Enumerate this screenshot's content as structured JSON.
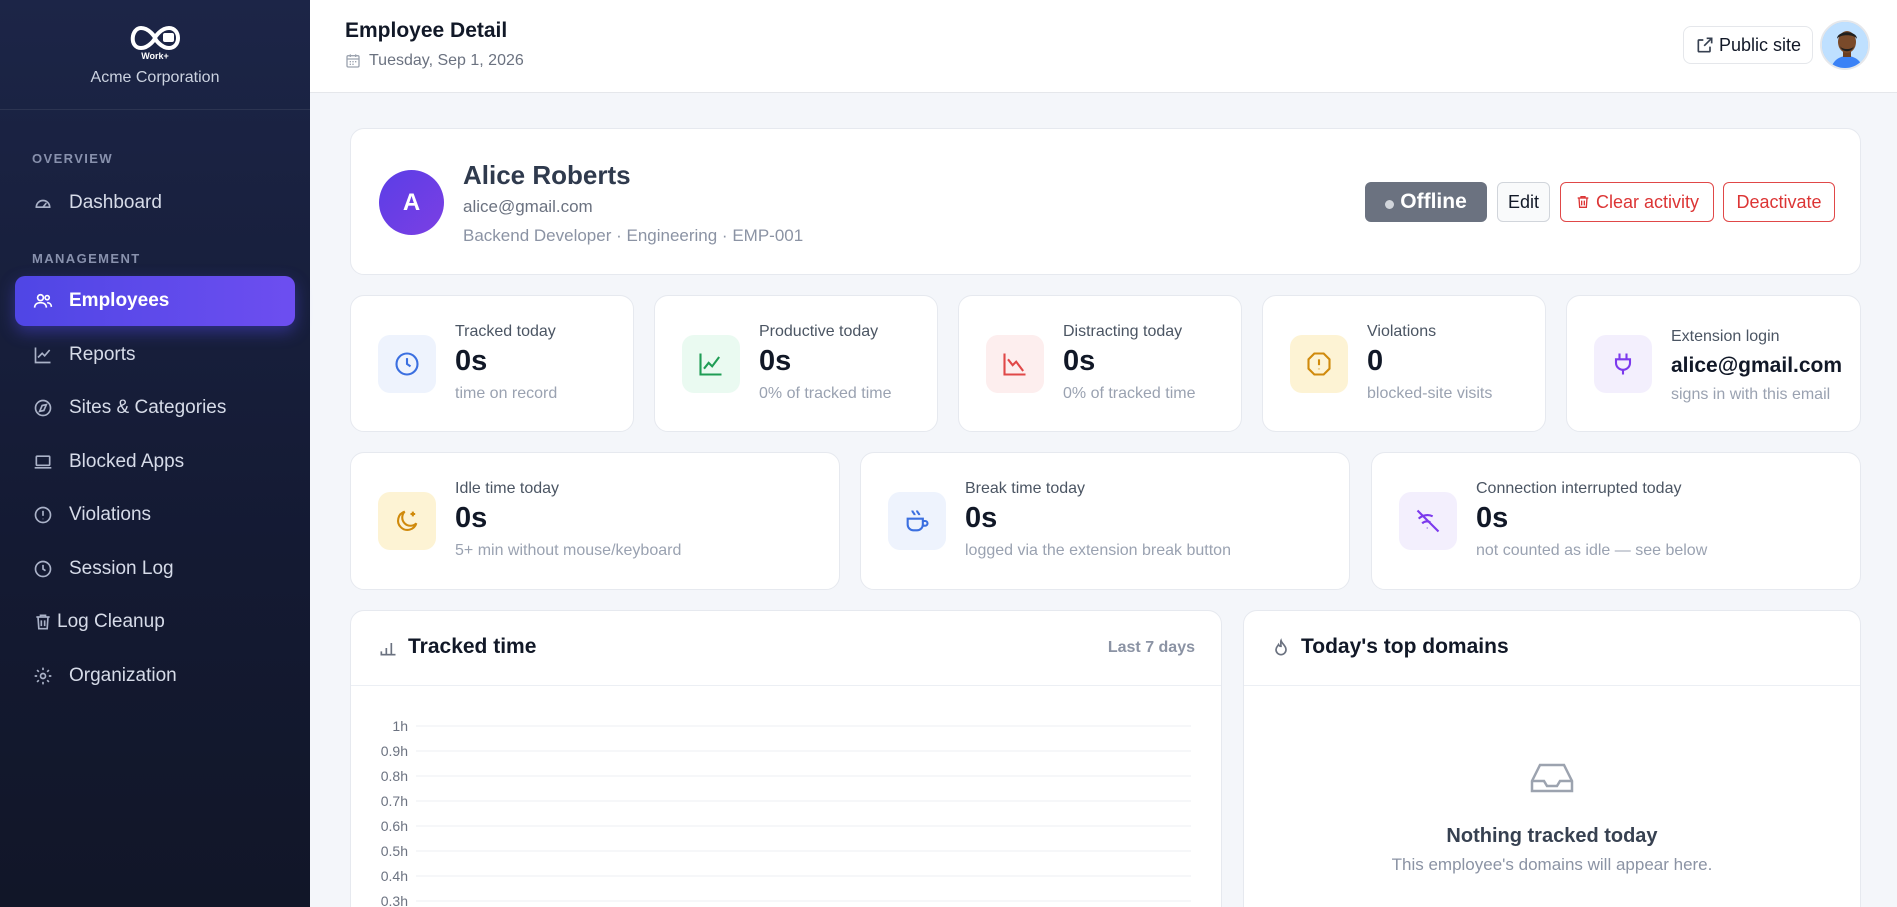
{
  "sidebar": {
    "brand_logo_text": "Work+",
    "org_name": "Acme Corporation",
    "sections": {
      "overview_label": "OVERVIEW",
      "management_label": "MANAGEMENT"
    },
    "items": [
      {
        "label": "Dashboard",
        "icon": "gauge-icon"
      },
      {
        "label": "Employees",
        "icon": "users-icon",
        "active": true
      },
      {
        "label": "Reports",
        "icon": "chart-line-icon"
      },
      {
        "label": "Sites & Categories",
        "icon": "compass-icon"
      },
      {
        "label": "Blocked Apps",
        "icon": "laptop-icon"
      },
      {
        "label": "Violations",
        "icon": "alert-circle-icon"
      },
      {
        "label": "Session Log",
        "icon": "clock-icon"
      },
      {
        "label": "Log Cleanup",
        "icon": "trash-icon"
      },
      {
        "label": "Organization",
        "icon": "gear-icon"
      }
    ]
  },
  "header": {
    "title": "Employee Detail",
    "date": "Tuesday, Sep 1, 2026",
    "public_site_label": "Public site"
  },
  "profile": {
    "initial": "A",
    "name": "Alice Roberts",
    "email": "alice@gmail.com",
    "meta": "Backend Developer · Engineering · EMP-001",
    "status": "Offline",
    "edit_label": "Edit",
    "clear_label": "Clear activity",
    "deactivate_label": "Deactivate"
  },
  "stats_row1": [
    {
      "label": "Tracked today",
      "value": "0s",
      "sub": "time on record",
      "icon": "clock-icon",
      "color": "#3b6fe0",
      "bg": "#eef3fd"
    },
    {
      "label": "Productive today",
      "value": "0s",
      "sub": "0% of tracked time",
      "icon": "trend-up-icon",
      "color": "#1f9d55",
      "bg": "#eafaf1"
    },
    {
      "label": "Distracting today",
      "value": "0s",
      "sub": "0% of tracked time",
      "icon": "trend-down-icon",
      "color": "#e04848",
      "bg": "#fdeeee"
    },
    {
      "label": "Violations",
      "value": "0",
      "sub": "blocked-site visits",
      "icon": "alert-octagon-icon",
      "color": "#d08a0c",
      "bg": "#fdf3d4"
    },
    {
      "label": "Extension login",
      "value": "alice@gmail.com",
      "sub": "signs in with this email",
      "icon": "plug-icon",
      "color": "#7c3aed",
      "bg": "#f3effd"
    }
  ],
  "stats_row2": [
    {
      "label": "Idle time today",
      "value": "0s",
      "sub": "5+ min without mouse/keyboard",
      "icon": "moon-icon",
      "color": "#d08a0c",
      "bg": "#fdf3d4"
    },
    {
      "label": "Break time today",
      "value": "0s",
      "sub": "logged via the extension break button",
      "icon": "coffee-icon",
      "color": "#3b6fe0",
      "bg": "#eef3fd"
    },
    {
      "label": "Connection interrupted today",
      "value": "0s",
      "sub": "not counted as idle — see below",
      "icon": "wifi-off-icon",
      "color": "#7c3aed",
      "bg": "#f3effd"
    }
  ],
  "tracked_panel": {
    "title": "Tracked time",
    "range": "Last 7 days",
    "icon": "bar-chart-icon"
  },
  "domains_panel": {
    "title": "Today's top domains",
    "icon": "flame-icon",
    "empty_title": "Nothing tracked today",
    "empty_sub": "This employee's domains will appear here."
  },
  "chart_data": {
    "type": "bar",
    "title": "Tracked time",
    "categories": [],
    "values": [],
    "y_ticks": [
      "1h",
      "0.9h",
      "0.8h",
      "0.7h",
      "0.6h",
      "0.5h",
      "0.4h",
      "0.3h"
    ],
    "ylim": [
      0,
      1
    ],
    "ylabel": "",
    "xlabel": "",
    "grid": true
  }
}
